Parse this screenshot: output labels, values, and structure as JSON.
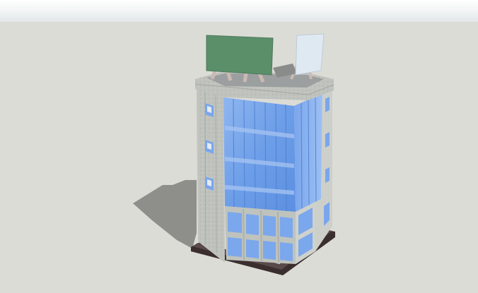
{
  "scene": {
    "colors": {
      "sky_top": "#ffffff",
      "sky_bottom": "#e2e6e8",
      "ground": "#dcdcd6",
      "shadow": "#8e8e8a",
      "concrete_front": "#bfc3bd",
      "concrete_side": "#d2d5cf",
      "glass": "#6f9fe6",
      "glass_light": "#9fc0f2",
      "base": "#3a2e2e",
      "billboard_green": "#5a8f6a",
      "billboard_white": "#dfe9f2"
    },
    "objects": [
      "ground-shadow",
      "building-base",
      "building-left-facade",
      "building-corner-glass-curtain-wall",
      "building-right-facade",
      "roof-parapet",
      "rooftop-billboard-green",
      "rooftop-billboard-white"
    ]
  }
}
